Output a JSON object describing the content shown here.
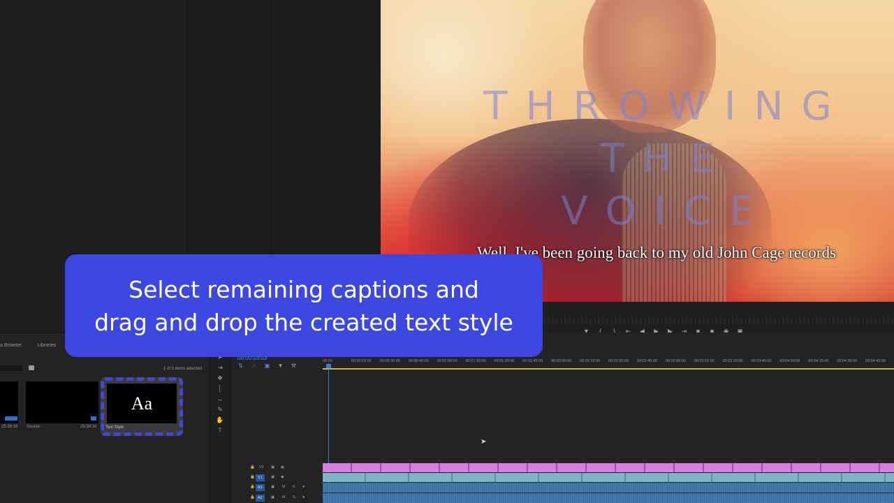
{
  "program_monitor": {
    "title_lines": [
      "THROWING",
      "THE",
      "VOICE"
    ],
    "caption": "Well, I've been going back to my old John Cage records",
    "controls": [
      "marker",
      "in",
      "out",
      "go-to-in",
      "step-back",
      "play",
      "step-forward",
      "go-to-out",
      "lift",
      "extract",
      "export-frame",
      "compare"
    ]
  },
  "project_panel": {
    "tabs": [
      "a Browser",
      "Libraries"
    ],
    "selection_count": "1 of 3 items selected",
    "items": [
      {
        "name": "",
        "duration": "25:39:16"
      },
      {
        "name": "Source",
        "duration": "25:39:16"
      },
      {
        "name": "Text Style",
        "thumbnail_text": "Aa"
      }
    ]
  },
  "timeline": {
    "timecode": "00:00:03:03",
    "ruler_labels": [
      "00:00",
      "00:00:15:00",
      "00:00:30:00",
      "00:00:45:00",
      "00:01:00:00",
      "00:01:15:00",
      "00:01:30:00",
      "00:01:45:00",
      "00:02:00:00",
      "00:02:15:00",
      "00:02:30:00",
      "00:02:45:00",
      "00:03:00:00",
      "00:03:15:00",
      "00:03:30:00",
      "00:03:45:00",
      "00:04:00:00",
      "00:04:15:00",
      "00:04:30:00",
      "00:04:45:00"
    ],
    "tracks": [
      "V2",
      "V1",
      "A1",
      "A2"
    ]
  },
  "instruction": {
    "line1": "Select remaining captions and",
    "line2": "drag and drop the created text style"
  },
  "colors": {
    "overlay": "#3d48e0",
    "caption_track": "#d57ee0",
    "video_track": "#7fb3c8",
    "audio_track": "#4a86c0",
    "accent": "#4a8fe8"
  }
}
